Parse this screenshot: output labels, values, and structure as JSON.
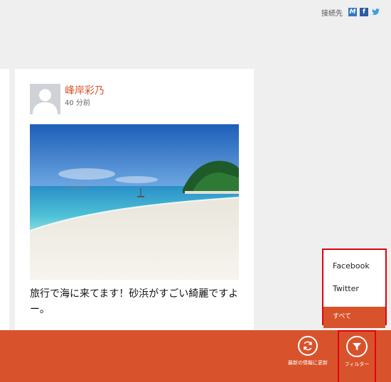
{
  "connect": {
    "label": "接続先",
    "services": [
      "M",
      "f",
      "t"
    ],
    "icons": [
      "messenger-icon",
      "facebook-icon",
      "twitter-icon"
    ]
  },
  "post": {
    "author": "峰岸彩乃",
    "time": "40 分前",
    "text": "旅行で海に来てます！砂浜がすごい綺麗ですよー。"
  },
  "filter_menu": {
    "items": [
      "Facebook",
      "Twitter",
      "すべて"
    ],
    "selected": "すべて"
  },
  "appbar": {
    "refresh_label": "最新の情報に更新",
    "filter_label": "フィルター"
  },
  "colors": {
    "accent": "#d8532b",
    "highlight_border": "#e0000f"
  }
}
